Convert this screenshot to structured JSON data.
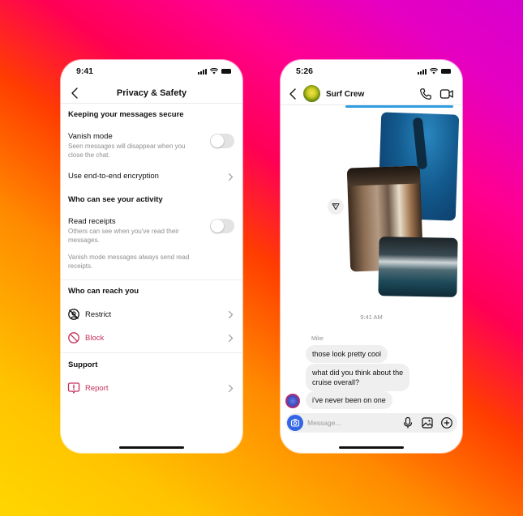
{
  "background": {
    "gradient_colors": [
      "#ffd600",
      "#ff8a00",
      "#ff3d00",
      "#ff0055",
      "#ff0090",
      "#d800d0"
    ]
  },
  "left_phone": {
    "status": {
      "time": "9:41"
    },
    "nav": {
      "title": "Privacy & Safety",
      "back_icon": "chevron-left-icon"
    },
    "sections": {
      "secure": {
        "heading": "Keeping your messages secure",
        "vanish_mode": {
          "title": "Vanish mode",
          "subtitle_line1": "Seen messages will disappear when you",
          "subtitle_line2": "close the chat.",
          "enabled": false
        },
        "encryption": {
          "title": "Use end-to-end encryption"
        }
      },
      "activity": {
        "heading": "Who can see your activity",
        "read_receipts": {
          "title": "Read receipts",
          "subtitle_line1": "Others can see when you've read their",
          "subtitle_line2": "messages.",
          "enabled": false
        },
        "note_line1": "Vanish mode messages always send read",
        "note_line2": "receipts."
      },
      "reach": {
        "heading": "Who can reach you",
        "restrict": {
          "label": "Restrict",
          "icon": "restrict-icon"
        },
        "block": {
          "label": "Block",
          "icon": "block-icon"
        }
      },
      "support": {
        "heading": "Support",
        "report": {
          "label": "Report",
          "icon": "report-icon"
        }
      }
    },
    "colors": {
      "danger": "#c5305a",
      "text": "#111111",
      "secondary": "#8e8e8e"
    }
  },
  "right_phone": {
    "status": {
      "time": "5:26"
    },
    "header": {
      "name": "Surf Crew",
      "call_icon": "phone-icon",
      "video_icon": "video-camera-icon"
    },
    "photos": [
      {
        "description": "Free diver underwater"
      },
      {
        "description": "Room with curtains"
      },
      {
        "description": "Indoor swimming pool"
      }
    ],
    "timestamp": "9:41 AM",
    "sender": "Mike",
    "messages": [
      {
        "text": "those look pretty cool"
      },
      {
        "text_line1": "what did you think about the",
        "text_line2": "cruise overall?"
      },
      {
        "text": "i've never been on one"
      }
    ],
    "composer": {
      "placeholder": "Message...",
      "value": ""
    },
    "colors": {
      "accent": "#3366e6",
      "bubble": "#efefef"
    }
  }
}
